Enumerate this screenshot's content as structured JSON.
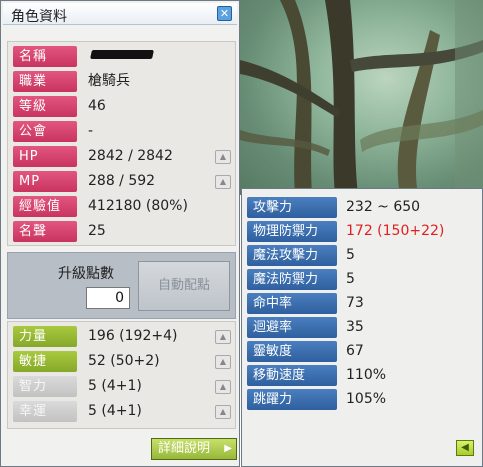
{
  "window": {
    "title": "角色資料",
    "close_icon": "close-icon"
  },
  "info": [
    {
      "key": "name",
      "label": "名稱",
      "value": ""
    },
    {
      "key": "job",
      "label": "職業",
      "value": "槍騎兵"
    },
    {
      "key": "level",
      "label": "等級",
      "value": "46"
    },
    {
      "key": "guild",
      "label": "公會",
      "value": "-"
    },
    {
      "key": "hp",
      "label": "HP",
      "value": "2842 / 2842"
    },
    {
      "key": "mp",
      "label": "MP",
      "value": "288 / 592"
    },
    {
      "key": "exp",
      "label": "經驗值",
      "value": "412180 (80%)"
    },
    {
      "key": "fame",
      "label": "名聲",
      "value": "25"
    }
  ],
  "ability_points": {
    "label": "升級點數",
    "value": "0",
    "auto_assign_label": "自動配點"
  },
  "stats": [
    {
      "key": "str",
      "label": "力量",
      "value": "196 (192+4)"
    },
    {
      "key": "dex",
      "label": "敏捷",
      "value": "52 (50+2)"
    },
    {
      "key": "int",
      "label": "智力",
      "value": "5 (4+1)"
    },
    {
      "key": "luk",
      "label": "幸運",
      "value": "5 (4+1)"
    }
  ],
  "detail_button_label": "詳細說明",
  "detail": [
    {
      "key": "attack",
      "label": "攻擊力",
      "value": "232 ~ 650"
    },
    {
      "key": "weapon_def",
      "label": "物理防禦力",
      "value": "172 (150+22)"
    },
    {
      "key": "magic_atk",
      "label": "魔法攻擊力",
      "value": "5"
    },
    {
      "key": "magic_def",
      "label": "魔法防禦力",
      "value": "5"
    },
    {
      "key": "accuracy",
      "label": "命中率",
      "value": "73"
    },
    {
      "key": "avoid",
      "label": "迴避率",
      "value": "35"
    },
    {
      "key": "hands",
      "label": "靈敏度",
      "value": "67"
    },
    {
      "key": "speed",
      "label": "移動速度",
      "value": "110%"
    },
    {
      "key": "jump",
      "label": "跳躍力",
      "value": "105%"
    }
  ],
  "colors": {
    "info_label": "#d8426d",
    "stat_label": "#97b83a",
    "detail_label": "#3f70b0",
    "highlight_value": "#e02020"
  }
}
